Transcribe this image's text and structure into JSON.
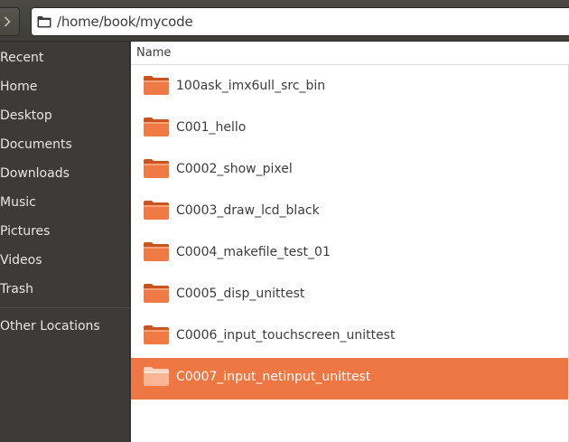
{
  "window": {
    "path": "/home/book/mycode"
  },
  "sidebar": {
    "items": [
      {
        "label": "Recent"
      },
      {
        "label": "Home"
      },
      {
        "label": "Desktop"
      },
      {
        "label": "Documents"
      },
      {
        "label": "Downloads"
      },
      {
        "label": "Music"
      },
      {
        "label": "Pictures"
      },
      {
        "label": "Videos"
      },
      {
        "label": "Trash"
      },
      {
        "label": "Other Locations"
      }
    ]
  },
  "list": {
    "column_name": "Name",
    "rows": [
      {
        "name": "100ask_imx6ull_src_bin",
        "selected": false
      },
      {
        "name": "C001_hello",
        "selected": false
      },
      {
        "name": "C0002_show_pixel",
        "selected": false
      },
      {
        "name": "C0003_draw_lcd_black",
        "selected": false
      },
      {
        "name": "C0004_makefile_test_01",
        "selected": false
      },
      {
        "name": "C0005_disp_unittest",
        "selected": false
      },
      {
        "name": "C0006_input_touchscreen_unittest",
        "selected": false
      },
      {
        "name": "C0007_input_netinput_unittest",
        "selected": true
      }
    ]
  },
  "colors": {
    "accent": "#ef7744",
    "sidebar_bg": "#3c3b37",
    "folder": "#e8652e"
  }
}
